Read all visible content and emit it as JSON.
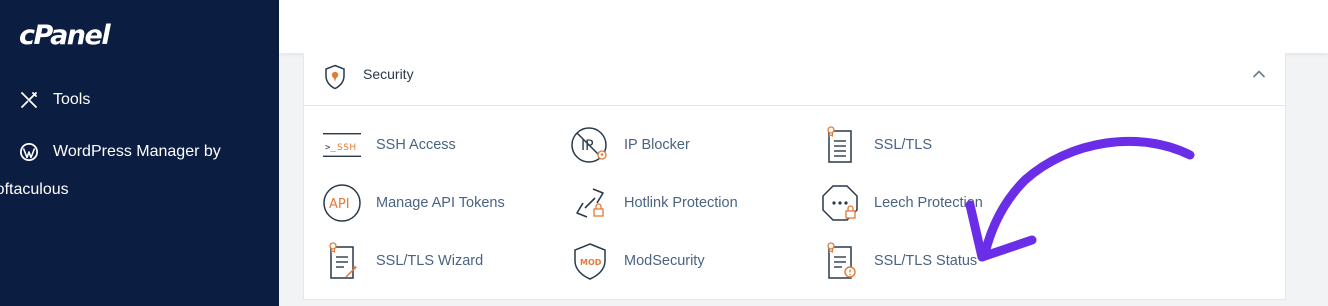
{
  "sidebar": {
    "logo": "cPanel",
    "items": [
      {
        "label": "Tools",
        "icon": "tools-icon"
      },
      {
        "label_line1": "WordPress Manager by",
        "label_line2": "Softaculous",
        "icon": "wordpress-icon"
      }
    ]
  },
  "section": {
    "title": "Security",
    "icon": "security-shield-icon",
    "expanded": true
  },
  "tools": [
    {
      "label": "SSH Access",
      "icon": "ssh-icon",
      "icon_text": ">_SSH"
    },
    {
      "label": "IP Blocker",
      "icon": "ip-blocker-icon",
      "icon_text": "IP"
    },
    {
      "label": "SSL/TLS",
      "icon": "ssl-tls-icon"
    },
    {
      "label": "Manage API Tokens",
      "icon": "api-icon",
      "icon_text": "API"
    },
    {
      "label": "Hotlink Protection",
      "icon": "hotlink-icon"
    },
    {
      "label": "Leech Protection",
      "icon": "leech-icon"
    },
    {
      "label": "SSL/TLS Wizard",
      "icon": "ssl-wizard-icon"
    },
    {
      "label": "ModSecurity",
      "icon": "modsecurity-icon",
      "icon_text": "MOD"
    },
    {
      "label": "SSL/TLS Status",
      "icon": "ssl-status-icon"
    }
  ],
  "colors": {
    "sidebar_bg": "#0b1d40",
    "accent_orange": "#e07b39",
    "link_text": "#4a6383",
    "annotation_arrow": "#6a2ee8"
  }
}
